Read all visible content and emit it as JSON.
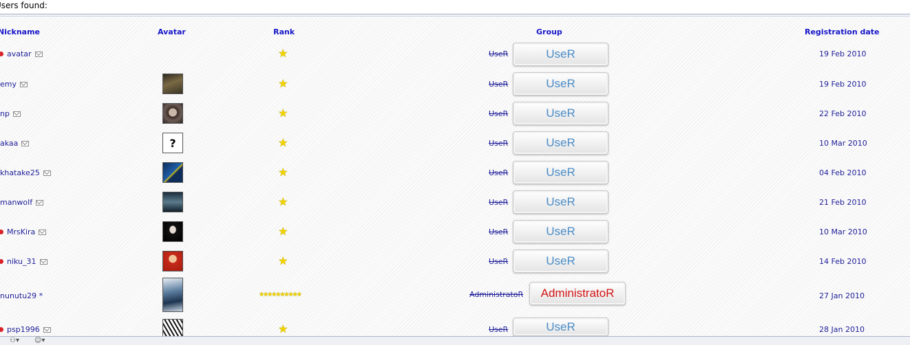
{
  "header": {
    "found_label": "Users found:"
  },
  "columns": {
    "nickname": "Nickname",
    "avatar": "Avatar",
    "rank": "Rank",
    "group": "Group",
    "regdate": "Registration date"
  },
  "rows": [
    {
      "nickname": "avatar",
      "online": true,
      "group": "UseR",
      "group_button": "UseR",
      "date": "19 Feb 2010"
    },
    {
      "nickname": "emy",
      "online": false,
      "group": "UseR",
      "group_button": "UseR",
      "date": "19 Feb 2010"
    },
    {
      "nickname": "np",
      "online": false,
      "group": "UseR",
      "group_button": "UseR",
      "date": "22 Feb 2010"
    },
    {
      "nickname": "akaa",
      "online": false,
      "group": "UseR",
      "group_button": "UseR",
      "date": "10 Mar 2010"
    },
    {
      "nickname": "khatake25",
      "online": false,
      "group": "UseR",
      "group_button": "UseR",
      "date": "04 Feb 2010"
    },
    {
      "nickname": "manwolf",
      "online": false,
      "group": "UseR",
      "group_button": "UseR",
      "date": "21 Feb 2010"
    },
    {
      "nickname": "MrsKira",
      "online": true,
      "group": "UseR",
      "group_button": "UseR",
      "date": "10 Mar 2010"
    },
    {
      "nickname": "niku_31",
      "online": true,
      "group": "UseR",
      "group_button": "UseR",
      "date": "14 Feb 2010"
    },
    {
      "nickname": "nunutu29 *",
      "online": false,
      "group": "AdministratoR",
      "group_button": "AdministratoR",
      "date": "27 Jan 2010"
    },
    {
      "nickname": "psp1996",
      "online": true,
      "group": "UseR",
      "group_button": "UseR",
      "date": "28 Jan 2010"
    }
  ],
  "colors": {
    "user_button_text": "#4a8cc7",
    "admin_button_text": "#d31515",
    "link": "#1d1d9a",
    "header": "#1515c8",
    "star": "#f1d300"
  },
  "icons": {
    "star": "star-icon",
    "mail": "envelope-icon",
    "online": "online-dot-icon"
  }
}
